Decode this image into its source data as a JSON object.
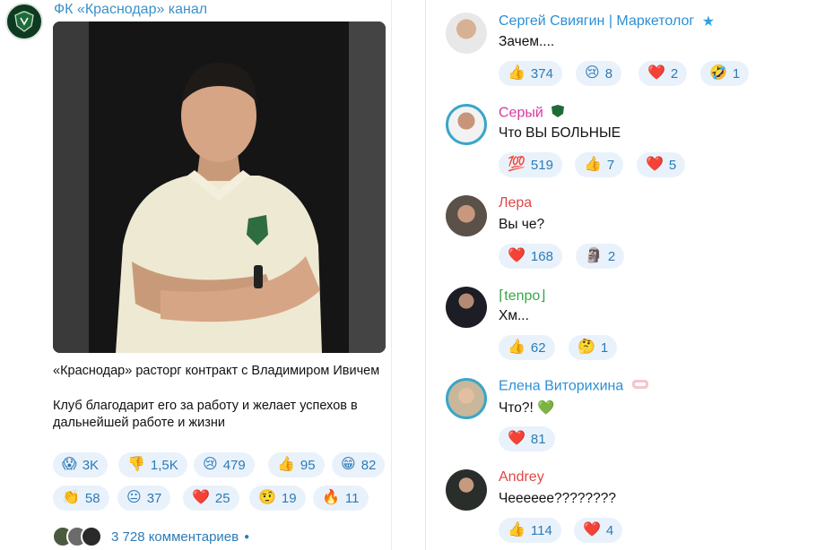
{
  "channel": {
    "name": "ФК «Краснодар» канал",
    "post_text_1": "«Краснодар» расторг контракт с Владимиром Ивичем",
    "post_text_2": "Клуб благодарит его за работу и желает успехов в дальнейшей работе и жизни",
    "reactions": [
      {
        "emoji": "😱",
        "count": "3K"
      },
      {
        "emoji": "👎",
        "count": "1,5K"
      },
      {
        "emoji": "😢",
        "count": "479"
      },
      {
        "emoji": "👍",
        "count": "95"
      },
      {
        "emoji": "😁",
        "count": "82"
      },
      {
        "emoji": "👏",
        "count": "58"
      },
      {
        "emoji": "😐",
        "count": "37"
      },
      {
        "emoji": "❤️",
        "count": "25"
      },
      {
        "emoji": "🤨",
        "count": "19"
      },
      {
        "emoji": "🔥",
        "count": "11"
      }
    ],
    "comments_count": "3 728 комментариев"
  },
  "comments": [
    {
      "author": "Сергей Свиягин | Маркетолог",
      "author_color": "#2d8fd5",
      "text": "Зачем....",
      "reactions": [
        {
          "emoji": "👍",
          "count": "374"
        },
        {
          "emoji": "😢",
          "count": "8"
        },
        {
          "emoji": "❤️",
          "count": "2"
        },
        {
          "emoji": "🤣",
          "count": "1"
        }
      ]
    },
    {
      "author": "Серый",
      "author_color": "#d63aa0",
      "text": "Что ВЫ БОЛЬНЫЕ",
      "reactions": [
        {
          "emoji": "💯",
          "count": "519"
        },
        {
          "emoji": "👍",
          "count": "7"
        },
        {
          "emoji": "❤️",
          "count": "5"
        }
      ]
    },
    {
      "author": "Лера",
      "author_color": "#e04848",
      "text": "Вы че?",
      "reactions": [
        {
          "emoji": "❤️",
          "count": "168"
        },
        {
          "emoji": "🗿",
          "count": "2"
        }
      ]
    },
    {
      "author": "⌈tenpo⌋",
      "author_color": "#3aa54a",
      "text": "Хм...",
      "reactions": [
        {
          "emoji": "👍",
          "count": "62"
        },
        {
          "emoji": "🤔",
          "count": "1"
        }
      ]
    },
    {
      "author": "Елена Виторихина",
      "author_color": "#2d8fd5",
      "text": "Что?! 💚",
      "reactions": [
        {
          "emoji": "❤️",
          "count": "81"
        }
      ]
    },
    {
      "author": "Andrey",
      "author_color": "#e04848",
      "text": "Чееееее????????",
      "reactions": [
        {
          "emoji": "👍",
          "count": "114"
        },
        {
          "emoji": "❤️",
          "count": "4"
        }
      ]
    }
  ],
  "colors": {
    "reaction_bg": "#e9f2fb",
    "reaction_text": "#2d7bb6",
    "channel_link": "#3a91c8"
  }
}
